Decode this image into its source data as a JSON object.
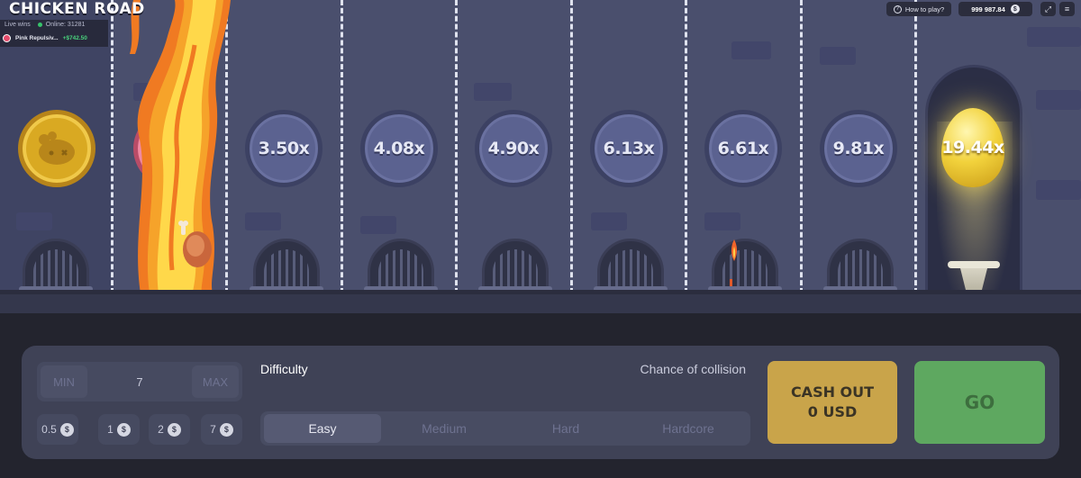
{
  "header": {
    "logo_text": "CHICKEN ROAD",
    "live_wins_label": "Live wins",
    "online_text": "Online: 31281",
    "recent_win": {
      "player": "Pink Repulsiv...",
      "amount": "+$742.50"
    },
    "how_to_play_label": "How to play?",
    "balance": "999 987.84",
    "currency_icon": "dollar-icon",
    "fullscreen_icon": "fullscreen-icon",
    "menu_icon": "hamburger-menu-icon"
  },
  "game": {
    "lanes": [
      {
        "state": "start",
        "icon": "chicken-coin-icon",
        "label": ""
      },
      {
        "state": "burned",
        "icon": "fire-icon",
        "label": ""
      },
      {
        "state": "pending",
        "label": "3.50x"
      },
      {
        "state": "pending",
        "label": "4.08x"
      },
      {
        "state": "pending",
        "label": "4.90x"
      },
      {
        "state": "pending",
        "label": "6.13x"
      },
      {
        "state": "pending",
        "label": "6.61x"
      },
      {
        "state": "pending",
        "label": "9.81x"
      },
      {
        "state": "finish",
        "icon": "golden-egg-icon",
        "label": "19.44x"
      }
    ],
    "colors": {
      "background": "#4a4f6d",
      "coin": "#5b6290",
      "fire": "#f2c94c",
      "gold": "#d9a922"
    }
  },
  "controls": {
    "bet": {
      "min_label": "MIN",
      "max_label": "MAX",
      "value": "7"
    },
    "quick_bets": [
      {
        "label": "0.5",
        "icon": "dollar-icon"
      },
      {
        "label": "1",
        "icon": "dollar-icon"
      },
      {
        "label": "2",
        "icon": "dollar-icon"
      },
      {
        "label": "7",
        "icon": "dollar-icon"
      }
    ],
    "difficulty_label": "Difficulty",
    "collision_label": "Chance of collision",
    "difficulty_tabs": [
      "Easy",
      "Medium",
      "Hard",
      "Hardcore"
    ],
    "selected_difficulty": "Easy",
    "cashout": {
      "line1": "CASH OUT",
      "line2": "0 USD",
      "color": "#c9a44a"
    },
    "go": {
      "label": "GO",
      "color": "#5ea860"
    }
  }
}
